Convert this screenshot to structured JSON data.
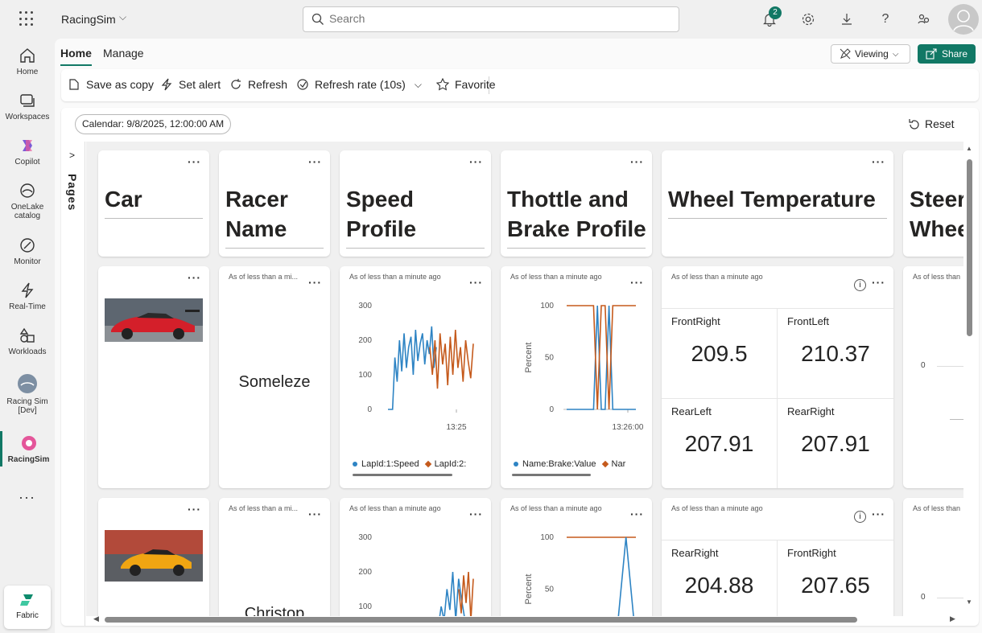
{
  "app": {
    "name": "RacingSim"
  },
  "search": {
    "placeholder": "Search"
  },
  "topbar": {
    "notification_count": "2"
  },
  "rail": [
    {
      "label": "Home"
    },
    {
      "label": "Workspaces"
    },
    {
      "label": "Copilot"
    },
    {
      "label": "OneLake catalog"
    },
    {
      "label": "Monitor"
    },
    {
      "label": "Real-Time"
    },
    {
      "label": "Workloads"
    },
    {
      "label": "Racing Sim [Dev]"
    },
    {
      "label": "RacingSim"
    },
    {
      "label": "..."
    },
    {
      "label": "Fabric"
    }
  ],
  "tabs": [
    {
      "label": "Home"
    },
    {
      "label": "Manage"
    }
  ],
  "header_actions": {
    "viewing": "Viewing",
    "share": "Share"
  },
  "toolbar": {
    "save_as_copy": "Save as copy",
    "set_alert": "Set alert",
    "refresh": "Refresh",
    "refresh_rate": "Refresh rate (10s)",
    "favorite": "Favorite"
  },
  "calendar": {
    "label": "Calendar: 9/8/2025, 12:00:00 AM"
  },
  "reset": {
    "label": "Reset"
  },
  "pages": {
    "label": "Pages"
  },
  "headers": [
    {
      "title_line1": "Car",
      "title_line2": ""
    },
    {
      "title_line1": "Racer",
      "title_line2": "Name"
    },
    {
      "title_line1": "Speed",
      "title_line2": "Profile"
    },
    {
      "title_line1": "Thottle and",
      "title_line2": "Brake Profile"
    },
    {
      "title_line1": "Wheel Temperature",
      "title_line2": ""
    },
    {
      "title_line1": "Steer",
      "title_line2": "Whee"
    }
  ],
  "asof": {
    "short": "As of less than a mi...",
    "long": "As of less than a minute ago",
    "cut": "As of less than"
  },
  "rows": [
    {
      "racer": "Someleze",
      "speed_legend": [
        "LapId:1:Speed",
        "LapId:2:"
      ],
      "brake_legend": [
        "Name:Brake:Value",
        "Nar"
      ],
      "speed_xtick": "13:25",
      "brake_xtick": "13:26:00",
      "wheels": [
        {
          "name": "FrontRight",
          "value": "209.5"
        },
        {
          "name": "FrontLeft",
          "value": "210.37"
        },
        {
          "name": "RearLeft",
          "value": "207.91"
        },
        {
          "name": "RearRight",
          "value": "207.91"
        }
      ]
    },
    {
      "racer": "Christop",
      "wheels": [
        {
          "name": "RearRight",
          "value": "204.88"
        },
        {
          "name": "FrontRight",
          "value": "207.65"
        }
      ]
    }
  ],
  "axes": {
    "speed_ticks": [
      "300",
      "200",
      "100",
      "0"
    ],
    "brake_ticks": [
      "100",
      "50",
      "0"
    ],
    "brake_ylabel": "Percent",
    "steer_tick": "0"
  },
  "colors": {
    "blue": "#2e84c4",
    "orange": "#c55a1c",
    "accent": "#117865"
  },
  "chart_data": [
    {
      "type": "line",
      "title": "Speed Profile",
      "ylim": [
        0,
        300
      ],
      "xlabel": "",
      "ylabel": "",
      "series": [
        {
          "name": "LapId:1:Speed",
          "values": [
            0,
            0,
            0,
            150,
            80,
            200,
            110,
            220,
            120,
            180,
            210,
            100,
            230,
            140,
            190,
            220,
            130,
            200,
            160,
            240,
            120,
            180
          ]
        },
        {
          "name": "LapId:2:",
          "values": [
            180,
            100,
            200,
            60,
            220,
            130,
            190,
            70,
            210,
            100,
            230,
            120,
            180,
            80,
            200,
            140,
            90,
            190
          ]
        }
      ]
    },
    {
      "type": "line",
      "title": "Thottle and Brake Profile",
      "ylim": [
        0,
        100
      ],
      "xlabel": "",
      "ylabel": "Percent",
      "series": [
        {
          "name": "Name:Brake:Value",
          "values": [
            0,
            0,
            0,
            0,
            0,
            0,
            0,
            0,
            100,
            0,
            0,
            100,
            0,
            0,
            0,
            0,
            0,
            0,
            0
          ]
        },
        {
          "name": "Nar",
          "values": [
            100,
            100,
            100,
            100,
            100,
            100,
            100,
            100,
            0,
            100,
            100,
            0,
            100,
            100,
            100,
            100,
            100,
            100,
            100
          ]
        }
      ]
    },
    {
      "type": "line",
      "title": "Speed Profile",
      "ylim": [
        0,
        300
      ],
      "series": [
        {
          "name": "blue",
          "values": [
            0,
            0,
            0,
            0,
            40,
            100,
            60,
            150,
            90,
            200,
            60,
            180,
            120,
            70
          ]
        },
        {
          "name": "orange",
          "values": [
            150,
            80,
            190,
            110,
            200,
            60,
            180
          ]
        }
      ]
    },
    {
      "type": "line",
      "title": "Thottle and Brake Profile",
      "ylim": [
        0,
        100
      ],
      "ylabel": "Percent",
      "series": [
        {
          "name": "orange",
          "values": [
            100,
            100,
            100,
            100,
            100,
            100,
            100,
            100
          ]
        },
        {
          "name": "blue",
          "values": [
            0,
            0,
            0,
            0,
            0,
            0,
            100,
            0
          ]
        }
      ]
    }
  ]
}
